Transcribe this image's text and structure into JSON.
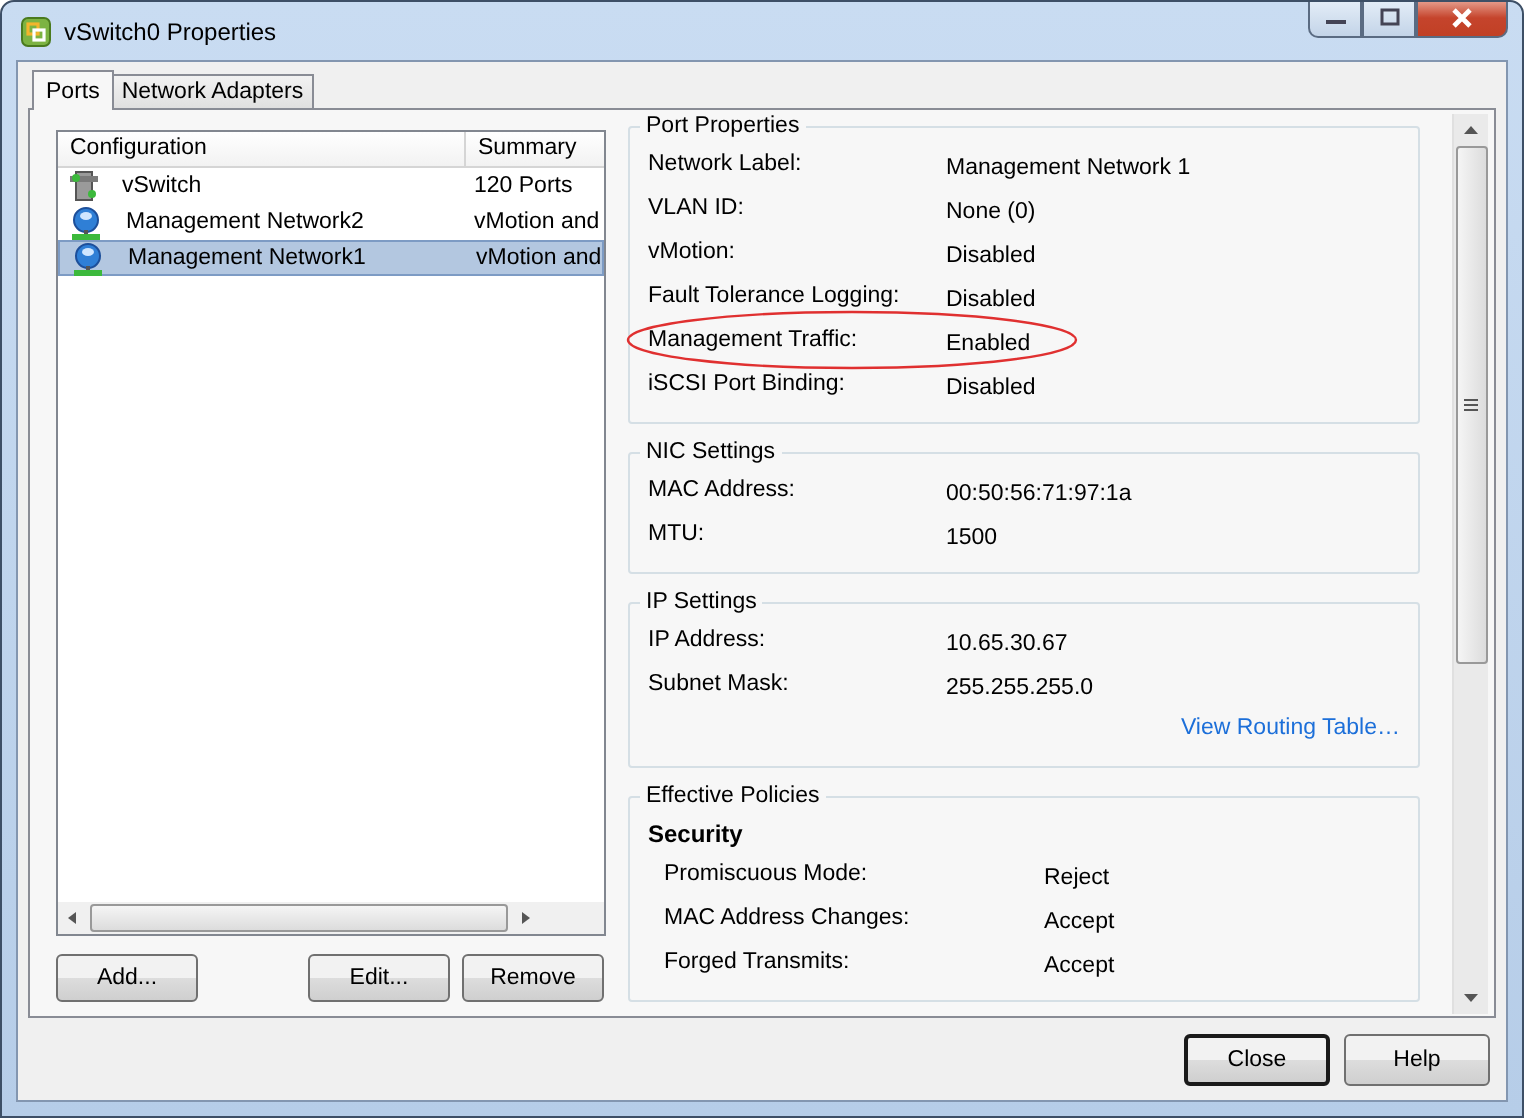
{
  "window": {
    "title": "vSwitch0 Properties"
  },
  "tabs": [
    {
      "label": "Ports",
      "selected": true
    },
    {
      "label": "Network Adapters",
      "selected": false
    }
  ],
  "list": {
    "columns": [
      "Configuration",
      "Summary"
    ],
    "rows": [
      {
        "kind": "switch",
        "name": "vSwitch",
        "summary": "120 Ports",
        "selected": false
      },
      {
        "kind": "network",
        "name": "Management Network2",
        "summary": "vMotion and",
        "selected": false
      },
      {
        "kind": "network",
        "name": "Management Network1",
        "summary": "vMotion and",
        "selected": true
      }
    ]
  },
  "list_buttons": [
    "Add...",
    "Edit...",
    "Remove"
  ],
  "sections": [
    {
      "title": "Port Properties",
      "rows": [
        {
          "label": "Network Label:",
          "value": "Management Network 1",
          "highlighted": false
        },
        {
          "label": "VLAN ID:",
          "value": "None (0)",
          "highlighted": false
        },
        {
          "label": "vMotion:",
          "value": "Disabled",
          "highlighted": false
        },
        {
          "label": "Fault Tolerance Logging:",
          "value": "Disabled",
          "highlighted": false
        },
        {
          "label": "Management Traffic:",
          "value": "Enabled",
          "highlighted": true
        },
        {
          "label": "iSCSI Port Binding:",
          "value": "Disabled",
          "highlighted": false
        }
      ]
    },
    {
      "title": "NIC Settings",
      "rows": [
        {
          "label": "MAC Address:",
          "value": "00:50:56:71:97:1a",
          "highlighted": false
        },
        {
          "label": "MTU:",
          "value": "1500",
          "highlighted": false
        }
      ]
    },
    {
      "title": "IP Settings",
      "rows": [
        {
          "label": "IP Address:",
          "value": "10.65.30.67",
          "highlighted": false
        },
        {
          "label": "Subnet Mask:",
          "value": "255.255.255.0",
          "highlighted": false
        }
      ],
      "link": "View Routing Table…"
    },
    {
      "title": "Effective Policies",
      "heading": "Security",
      "rows": [
        {
          "label": "Promiscuous Mode:",
          "value": "Reject",
          "highlighted": false
        },
        {
          "label": "MAC Address Changes:",
          "value": "Accept",
          "highlighted": false
        },
        {
          "label": "Forged Transmits:",
          "value": "Accept",
          "highlighted": false
        }
      ]
    }
  ],
  "buttons": [
    {
      "label": "Close",
      "default": true
    },
    {
      "label": "Help",
      "default": false
    }
  ]
}
